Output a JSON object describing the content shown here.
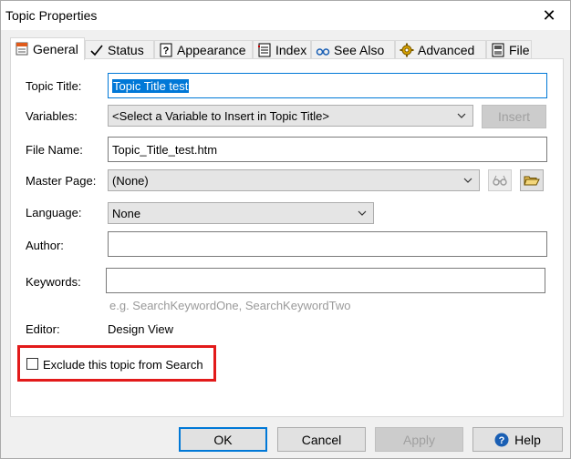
{
  "window": {
    "title": "Topic Properties",
    "close_glyph": "✕"
  },
  "tabs": [
    {
      "label": "General",
      "icon": "general-tab-icon"
    },
    {
      "label": "Status",
      "icon": "checkmark-icon"
    },
    {
      "label": "Appearance",
      "icon": "question-icon"
    },
    {
      "label": "Index",
      "icon": "index-icon"
    },
    {
      "label": "See Also",
      "icon": "glasses-icon"
    },
    {
      "label": "Advanced",
      "icon": "gear-icon"
    },
    {
      "label": "File",
      "icon": "file-icon"
    }
  ],
  "form": {
    "topic_title_label": "Topic Title:",
    "topic_title_value": "Topic Title test",
    "variables_label": "Variables:",
    "variables_value": "<Select a Variable to Insert in Topic Title>",
    "insert_label": "Insert",
    "file_name_label": "File Name:",
    "file_name_value": "Topic_Title_test.htm",
    "master_page_label": "Master Page:",
    "master_page_value": "(None)",
    "language_label": "Language:",
    "language_value": "None",
    "author_label": "Author:",
    "author_value": "",
    "keywords_label": "Keywords:",
    "keywords_value": "",
    "keywords_hint": "e.g. SearchKeywordOne, SearchKeywordTwo",
    "editor_label": "Editor:",
    "editor_value": "Design View",
    "exclude_label": "Exclude this topic from Search",
    "exclude_checked": false
  },
  "buttons": {
    "ok": "OK",
    "cancel": "Cancel",
    "apply": "Apply",
    "help": "Help"
  },
  "colors": {
    "accent": "#0078d7",
    "highlight": "#e21a1a"
  }
}
